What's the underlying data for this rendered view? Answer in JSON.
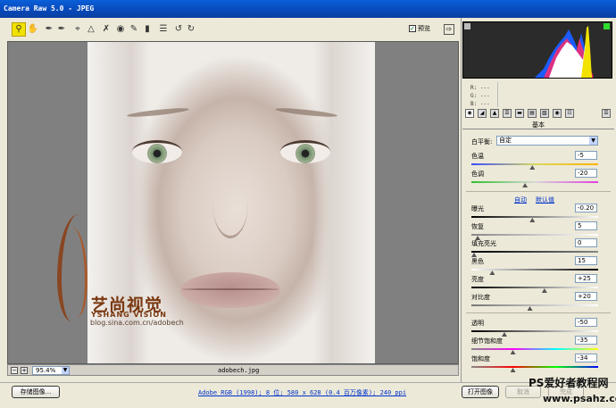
{
  "window": {
    "title": "Camera Raw 5.0 -  JPEG"
  },
  "toolbar": {
    "tools": [
      "zoom-icon",
      "hand-icon",
      "white-balance-icon",
      "color-sampler-icon",
      "crop-icon",
      "straighten-icon",
      "spot-removal-icon",
      "red-eye-icon",
      "adjustment-brush-icon",
      "graduated-filter-icon",
      "preferences-icon",
      "rotate-left-icon",
      "rotate-right-icon"
    ],
    "preview_label": "预览",
    "preview_checked": true
  },
  "image": {
    "watermark_title": "艺尚视觉",
    "watermark_brand": "YSHANG VISION",
    "watermark_blog": "blog.sina.com.cn/adobech"
  },
  "zoom": {
    "minus": "−",
    "plus": "+",
    "level": "95.4%",
    "filename": "adobech.jpg"
  },
  "histogram": {
    "r_label": "R:",
    "g_label": "G:",
    "b_label": "B:",
    "r": "---",
    "g": "---",
    "b": "---"
  },
  "panel": {
    "section_title": "基本",
    "white_balance_label": "白平衡:",
    "white_balance_value": "自定",
    "auto_link": "自动",
    "default_link": "默认值",
    "sliders": [
      {
        "label": "色温",
        "value": "-5",
        "pos": 0.48
      },
      {
        "label": "色调",
        "value": "-20",
        "pos": 0.42
      },
      {
        "label": "曝光",
        "value": "-0.20",
        "pos": 0.48
      },
      {
        "label": "恢复",
        "value": "5",
        "pos": 0.03
      },
      {
        "label": "填充亮光",
        "value": "0",
        "pos": 0.0
      },
      {
        "label": "黑色",
        "value": "15",
        "pos": 0.15
      },
      {
        "label": "亮度",
        "value": "+25",
        "pos": 0.58
      },
      {
        "label": "对比度",
        "value": "+20",
        "pos": 0.46
      },
      {
        "label": "透明",
        "value": "-50",
        "pos": 0.25
      },
      {
        "label": "细节饱和度",
        "value": "-35",
        "pos": 0.32
      },
      {
        "label": "饱和度",
        "value": "-34",
        "pos": 0.32
      }
    ]
  },
  "bottom": {
    "save_label": "存储图像...",
    "info": "Adobe RGB (1998); 8 位; 580 x 628 (0.4 百万像素); 240 ppi",
    "open_label": "打开图像",
    "site_line1": "PS爱好者教程网",
    "site_line2": "www.psahz.com",
    "cancel_label": "取消",
    "done_label": "完成"
  },
  "colors": {
    "accent_yellow": "#f2e200",
    "link_blue": "#0033cc",
    "title_blue": "#0a5fd8"
  }
}
